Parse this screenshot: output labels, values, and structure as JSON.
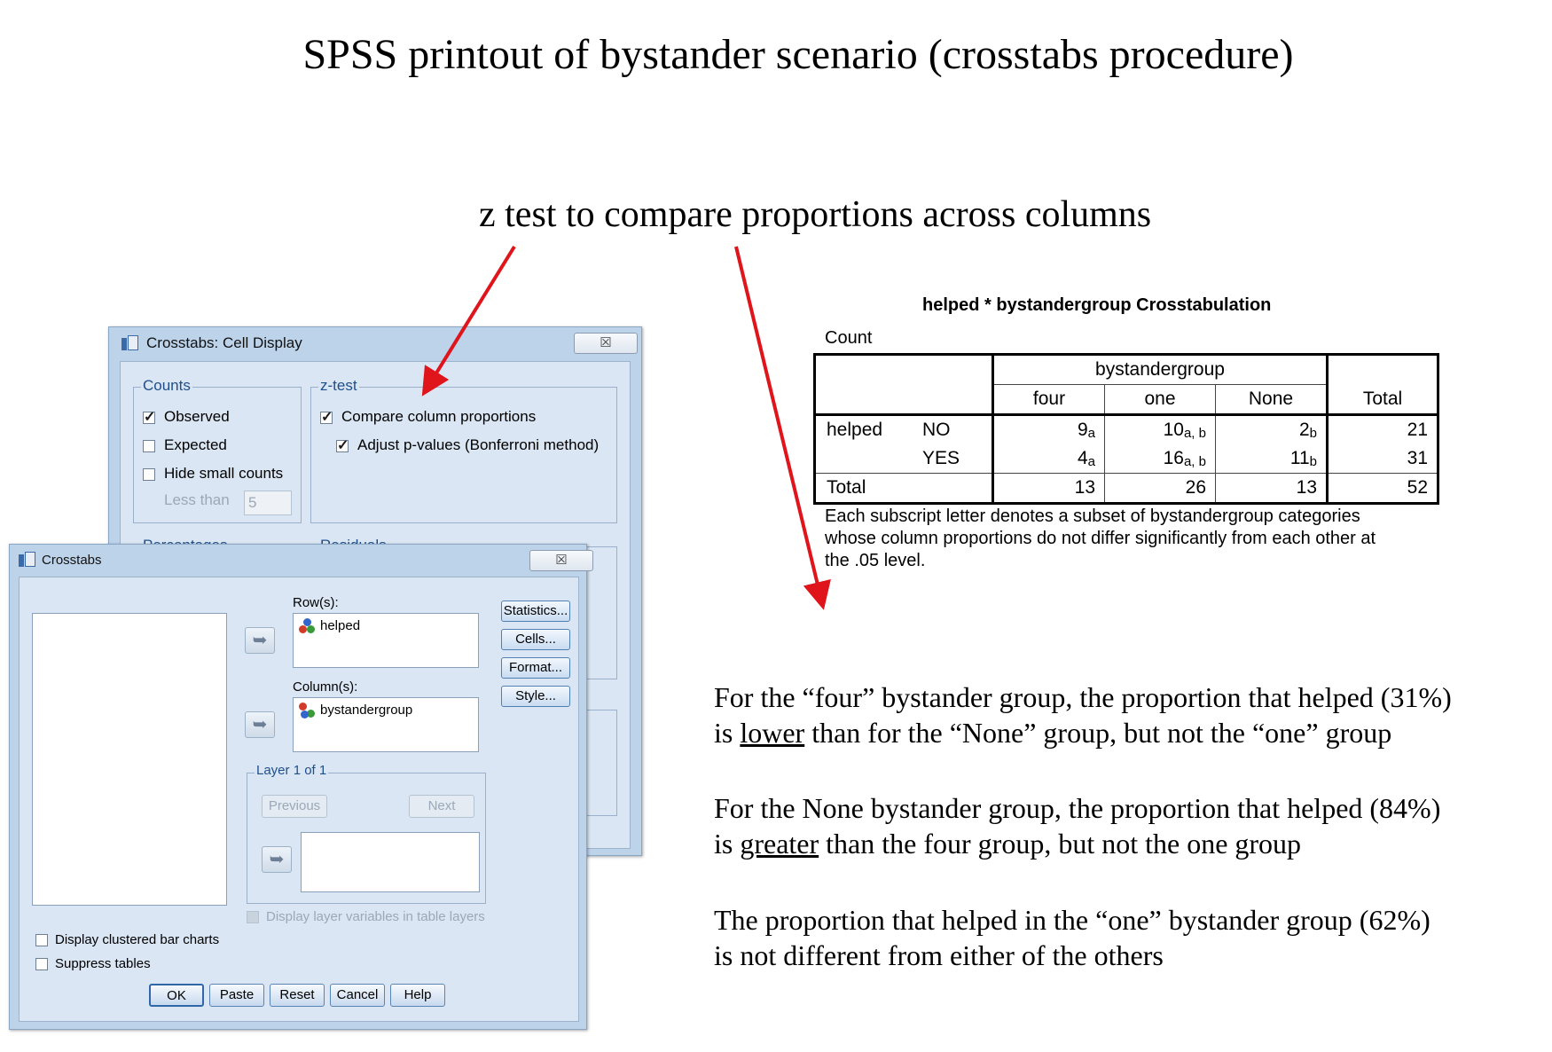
{
  "slide": {
    "title": "SPSS printout of bystander scenario (crosstabs procedure)",
    "subtitle": "z test to compare proportions across columns"
  },
  "cell_display": {
    "title": "Crosstabs: Cell Display",
    "close_glyph": "☒",
    "counts": {
      "legend": "Counts",
      "observed": "Observed",
      "observed_checked": true,
      "expected": "Expected",
      "expected_checked": false,
      "hide_small": "Hide small counts",
      "hide_small_checked": false,
      "less_than_label": "Less than",
      "less_than_value": "5"
    },
    "ztest": {
      "legend": "z-test",
      "compare": "Compare column proportions",
      "compare_checked": true,
      "adjust": "Adjust p-values (Bonferroni method)",
      "adjust_checked": true
    },
    "percentages_legend": "Percentages",
    "residuals_legend": "Residuals"
  },
  "crosstabs": {
    "title": "Crosstabs",
    "close_glyph": "☒",
    "rows_label": "Row(s):",
    "row_var": "helped",
    "columns_label": "Column(s):",
    "col_var": "bystandergroup",
    "layer_legend": "Layer 1 of 1",
    "previous": "Previous",
    "next": "Next",
    "display_layer": "Display layer variables in table layers",
    "clustered": "Display clustered bar charts",
    "suppress": "Suppress tables",
    "side_buttons": [
      "Statistics...",
      "Cells...",
      "Format...",
      "Style..."
    ],
    "bottom_buttons": [
      "OK",
      "Paste",
      "Reset",
      "Cancel",
      "Help"
    ]
  },
  "table": {
    "title": "helped * bystandergroup Crosstabulation",
    "count_label": "Count",
    "col_group": "bystandergroup",
    "cols": [
      "four",
      "one",
      "None"
    ],
    "total_label": "Total",
    "row_var": "helped",
    "rows": [
      {
        "label": "NO",
        "cells": [
          {
            "v": "9",
            "s": "a"
          },
          {
            "v": "10",
            "s": "a, b"
          },
          {
            "v": "2",
            "s": "b"
          }
        ],
        "total": "21"
      },
      {
        "label": "YES",
        "cells": [
          {
            "v": "4",
            "s": "a"
          },
          {
            "v": "16",
            "s": "a, b"
          },
          {
            "v": "11",
            "s": "b"
          }
        ],
        "total": "31"
      }
    ],
    "totals": [
      "13",
      "26",
      "13",
      "52"
    ],
    "footnote": "Each subscript letter denotes a subset of bystandergroup categories whose column proportions do not differ significantly from each other at the .05 level."
  },
  "notes": {
    "p1_line1": "For the “four” bystander group, the proportion that helped (31%)",
    "p1_pre": "is ",
    "p1_u": "lower",
    "p1_post": " than for the “None” group, but not the “one” group",
    "p2_line1": "For the None bystander group, the proportion that helped (84%)",
    "p2_pre": "is ",
    "p2_u": "greater",
    "p2_post": " than the four group, but not the one group",
    "p3_line1": "The proportion that helped in the “one” bystander group (62%)",
    "p3_line2": "is not different from either of the others"
  },
  "colors": {
    "arrow": "#e0141b",
    "dialog_bg": "#dae6f3",
    "legend_text": "#1f4f8b"
  }
}
